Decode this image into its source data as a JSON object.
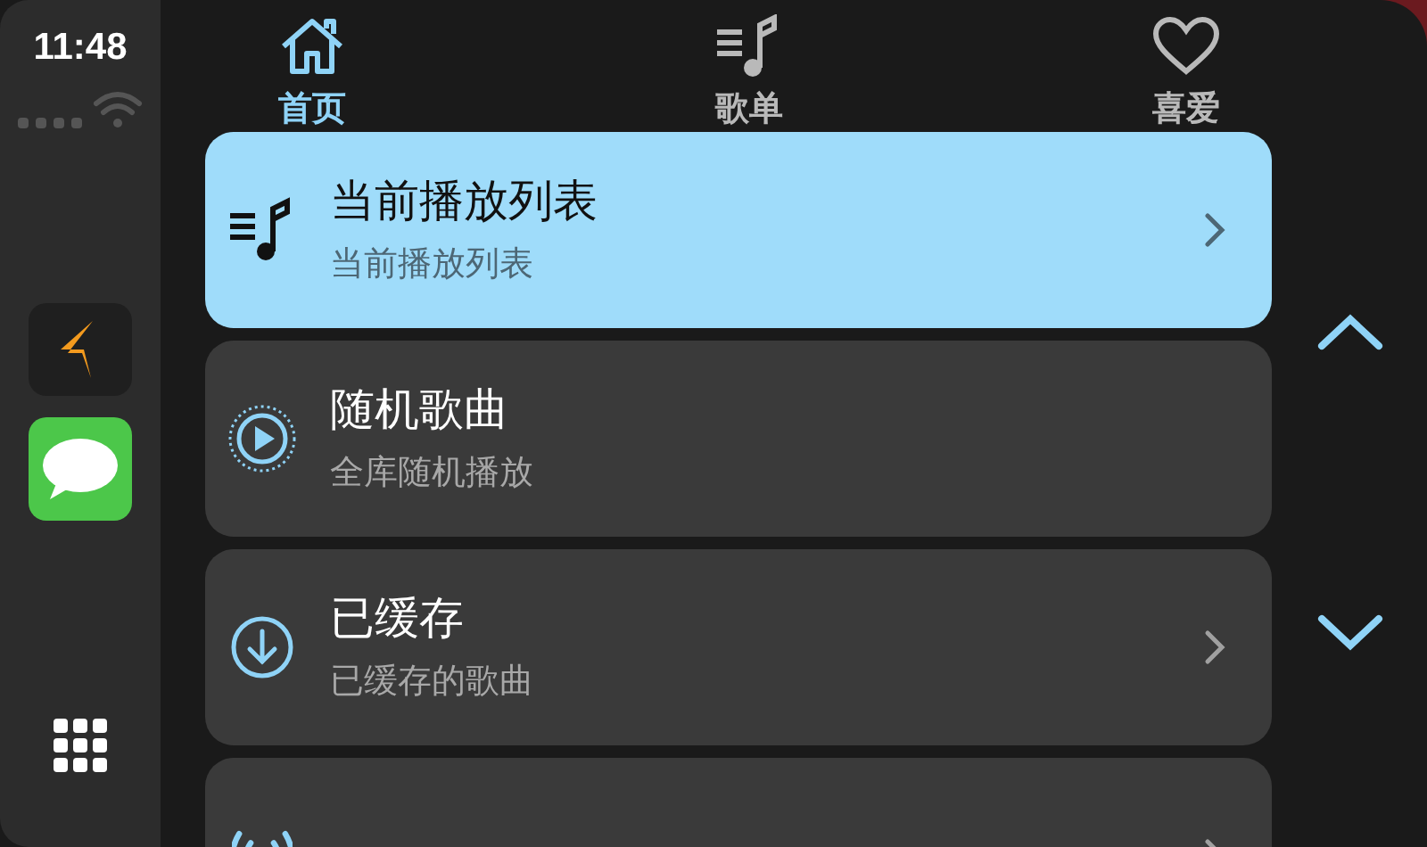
{
  "status": {
    "time": "11:48"
  },
  "dock": [
    {
      "kind": "nav-app"
    },
    {
      "kind": "messages"
    }
  ],
  "tabs": [
    {
      "label": "首页",
      "kind": "home",
      "selected": true
    },
    {
      "label": "歌单",
      "kind": "playlist",
      "selected": false
    },
    {
      "label": "喜爱",
      "kind": "heart",
      "selected": false
    }
  ],
  "rows": [
    {
      "title": "当前播放列表",
      "subtitle": "当前播放列表",
      "kind": "playlist",
      "selected": true,
      "chevron": true
    },
    {
      "title": "随机歌曲",
      "subtitle": "全库随机播放",
      "kind": "shuffle-play",
      "selected": false,
      "chevron": false
    },
    {
      "title": "已缓存",
      "subtitle": "已缓存的歌曲",
      "kind": "download",
      "selected": false,
      "chevron": true
    },
    {
      "kind": "radio",
      "selected": false,
      "chevron": true
    }
  ]
}
